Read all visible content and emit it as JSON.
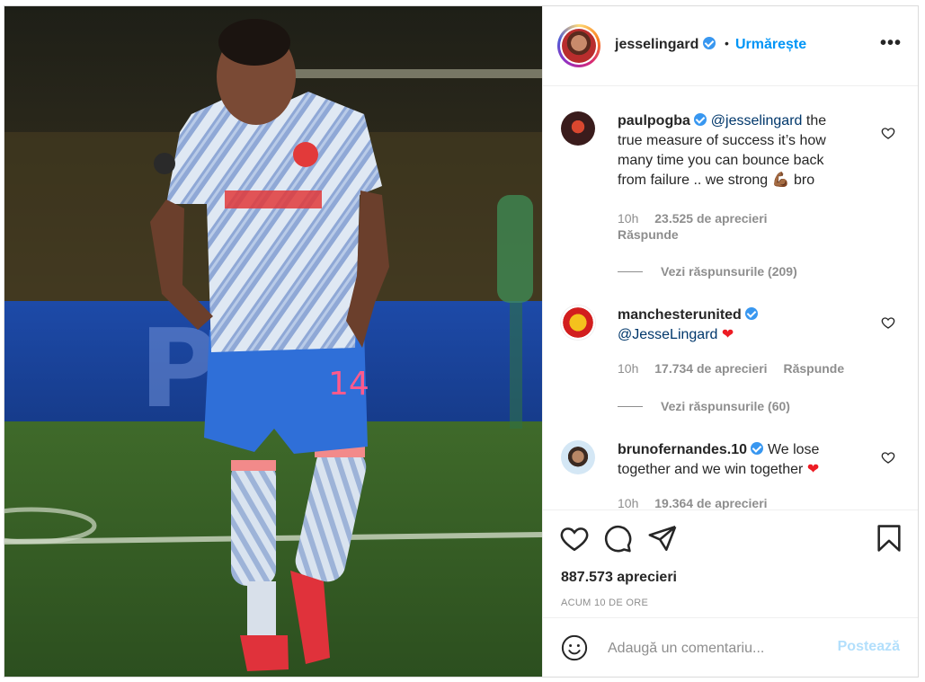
{
  "post": {
    "author": "jesselingard",
    "follow_label": "Urmărește",
    "separator": "•",
    "more_label": "•••",
    "likes": "887.573 aprecieri",
    "time_ago": "ACUM 10 DE ORE"
  },
  "comments": [
    {
      "user": "paulpogba",
      "mention": "@jesselingard",
      "text": "the true measure of success it’s how many time you can bounce back from failure .. we strong",
      "emoji": "💪🏾",
      "text_after": "bro",
      "time": "10h",
      "likes": "23.525 de aprecieri",
      "reply_label": "Răspunde",
      "view_replies": "Vezi răspunsurile (209)"
    },
    {
      "user": "manchesterunited",
      "mention": "@JesseLingard",
      "emoji": "❤",
      "time": "10h",
      "likes": "17.734 de aprecieri",
      "reply_label": "Răspunde",
      "view_replies": "Vezi răspunsurile (60)"
    },
    {
      "user": "brunofernandes.10",
      "text": "We lose together and we win together",
      "emoji": "❤",
      "time": "10h",
      "likes": "19.364 de aprecieri"
    }
  ],
  "composer": {
    "placeholder": "Adaugă un comentariu...",
    "post_label": "Postează"
  },
  "colors": {
    "accent": "#0095f6",
    "verified": "#3897f0",
    "post_disabled": "#b2dffc",
    "heart_red": "#ed4956"
  }
}
